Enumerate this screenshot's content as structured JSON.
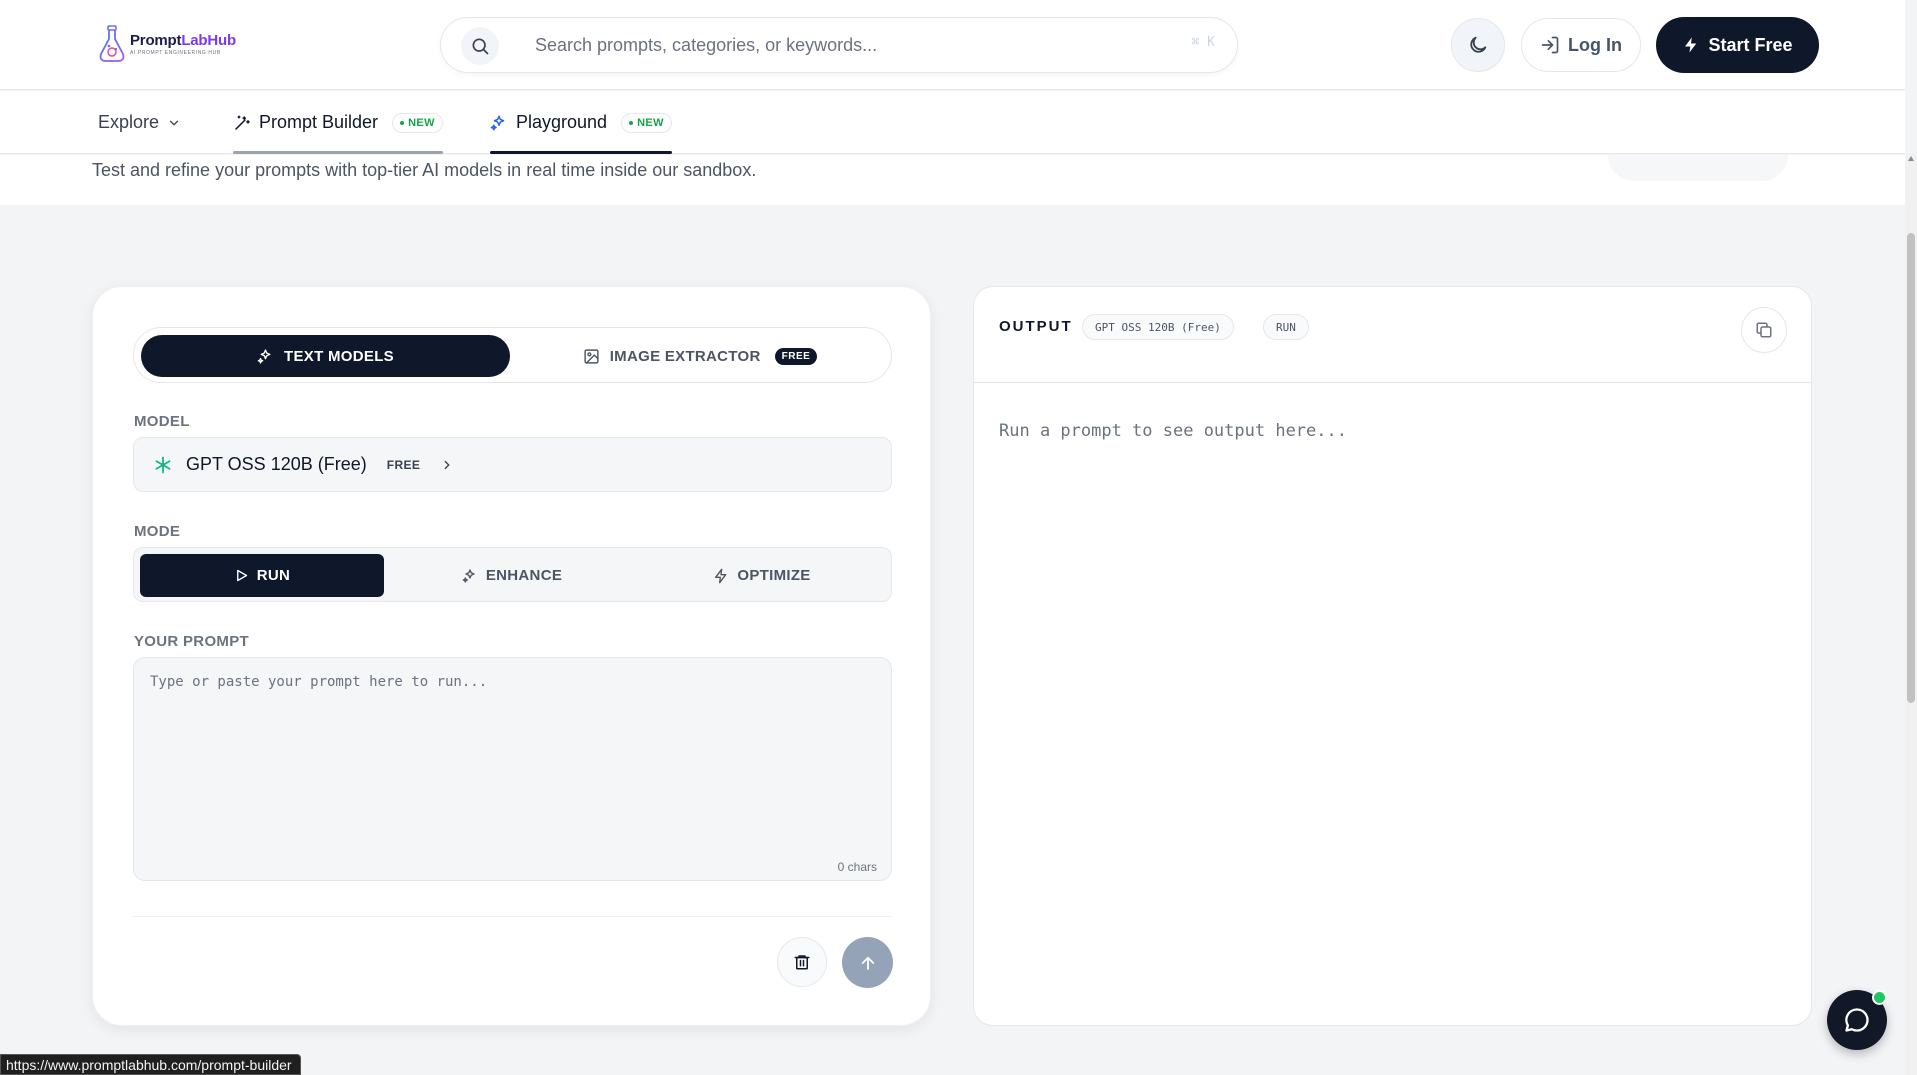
{
  "header": {
    "logo_name_part1": "Prompt",
    "logo_name_part2": "LabHub",
    "logo_tagline": "AI PROMPT ENGINEERING HUB",
    "search_placeholder": "Search prompts, categories, or keywords...",
    "search_shortcut": "⌘ K",
    "login_label": "Log In",
    "start_label": "Start Free"
  },
  "nav": {
    "explore_label": "Explore",
    "builder_label": "Prompt Builder",
    "builder_badge": "NEW",
    "playground_label": "Playground",
    "playground_badge": "NEW"
  },
  "hero": {
    "subtitle": "Test and refine your prompts with top-tier AI models in real time inside our sandbox."
  },
  "left_panel": {
    "tab_text_models": "TEXT MODELS",
    "tab_image_extractor": "IMAGE EXTRACTOR",
    "tab_image_badge": "FREE",
    "model_label": "MODEL",
    "model_name": "GPT OSS 120B (Free)",
    "model_tier": "FREE",
    "mode_label": "MODE",
    "mode_run": "RUN",
    "mode_enhance": "ENHANCE",
    "mode_optimize": "OPTIMIZE",
    "prompt_label": "YOUR PROMPT",
    "prompt_placeholder": "Type or paste your prompt here to run...",
    "char_count": "0 chars"
  },
  "output_panel": {
    "title": "OUTPUT",
    "model_chip": "GPT OSS 120B (Free)",
    "mode_chip": "RUN",
    "placeholder": "Run a prompt to see output here..."
  },
  "status_bar": {
    "url": "https://www.promptlabhub.com/prompt-builder"
  },
  "colors": {
    "primary_dark": "#0f172a",
    "accent_green": "#16a34a",
    "model_icon": "#10b981",
    "send_disabled": "#94a3b8"
  },
  "icons": {
    "search": "search-icon",
    "theme": "moon-icon",
    "login": "login-icon",
    "start": "lightning-icon",
    "builder": "wand-icon",
    "playground": "sparkles-icon",
    "image": "image-icon",
    "model": "asterisk-icon",
    "run": "play-icon",
    "optimize": "lightning-icon",
    "copy": "copy-icon",
    "trash": "trash-icon",
    "send": "arrow-up-icon",
    "chat": "chat-icon"
  }
}
